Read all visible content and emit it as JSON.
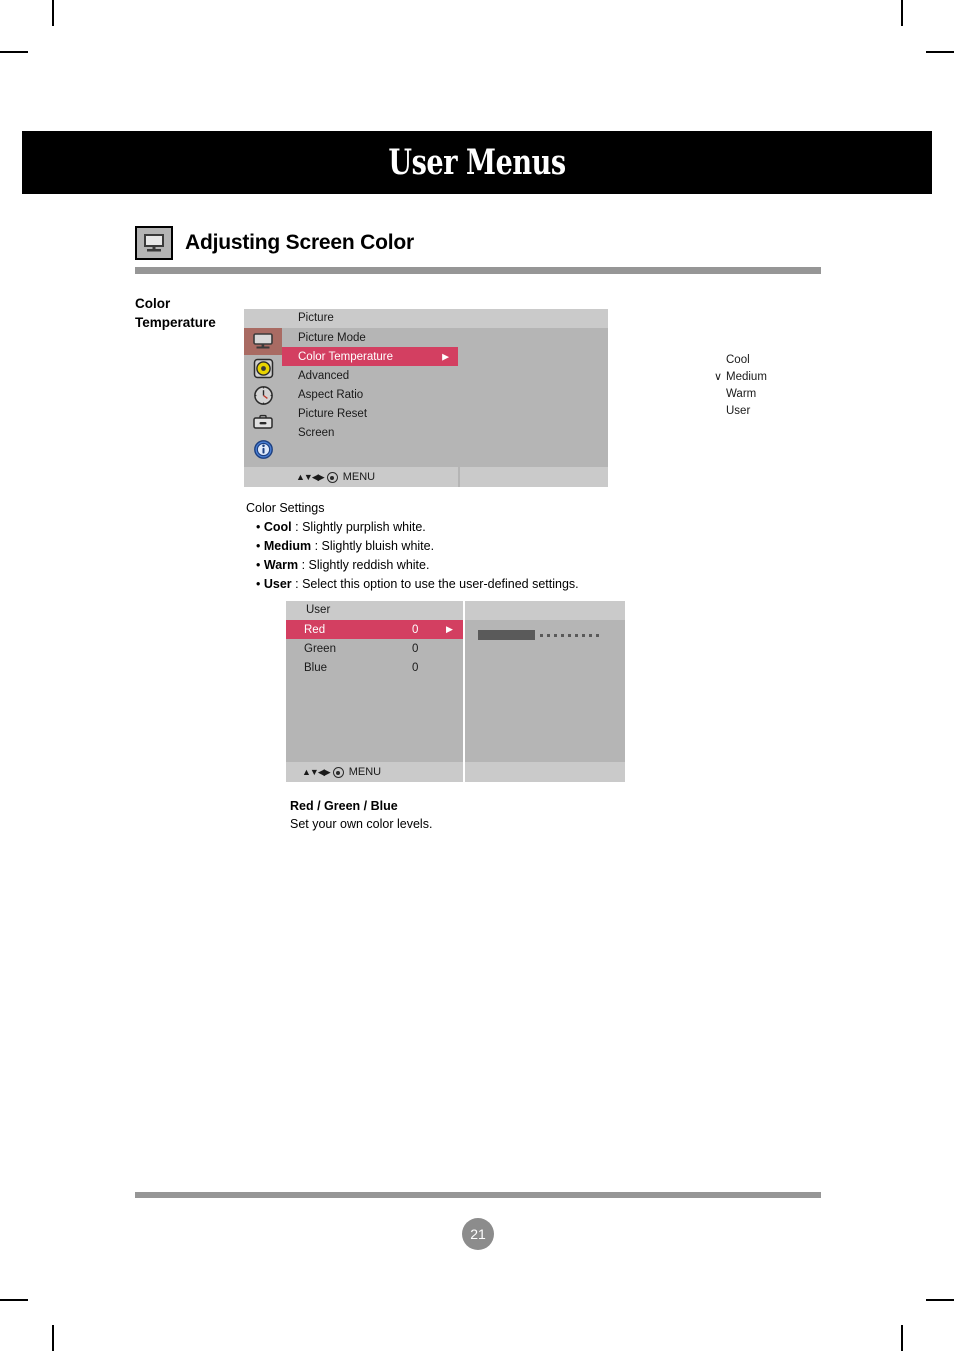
{
  "banner": {
    "title": "User Menus"
  },
  "section": {
    "icon": "monitor-icon",
    "title": "Adjusting Screen Color"
  },
  "side_label": "Color\nTemperature",
  "side_label_line1": "Color",
  "side_label_line2": "Temperature",
  "osd_picture": {
    "header_title": "Picture",
    "rail_icons": [
      {
        "name": "monitor-icon",
        "selected": true
      },
      {
        "name": "audio-disc-icon",
        "selected": false
      },
      {
        "name": "clock-icon",
        "selected": false
      },
      {
        "name": "toolbox-icon",
        "selected": false
      },
      {
        "name": "info-icon",
        "selected": false
      }
    ],
    "menu_items": [
      {
        "label": "Picture Mode",
        "highlighted": false,
        "arrow": ""
      },
      {
        "label": "Color Temperature",
        "highlighted": true,
        "arrow": "▶"
      },
      {
        "label": "Advanced",
        "highlighted": false,
        "arrow": ""
      },
      {
        "label": "Aspect Ratio",
        "highlighted": false,
        "arrow": ""
      },
      {
        "label": "Picture Reset",
        "highlighted": false,
        "arrow": ""
      },
      {
        "label": "Screen",
        "highlighted": false,
        "arrow": ""
      }
    ],
    "options": [
      {
        "label": "Cool",
        "check": ""
      },
      {
        "label": "Medium",
        "check": "∨"
      },
      {
        "label": "Warm",
        "check": ""
      },
      {
        "label": "User",
        "check": ""
      }
    ],
    "footer": {
      "nav_up": "▲",
      "nav_down": "▼",
      "nav_left": "◀",
      "nav_right": "▶",
      "enter": "enter-dot-icon",
      "menu_label": "MENU"
    },
    "highlight_color": "#d33f61"
  },
  "explanation": {
    "heading": "Color Settings",
    "items": [
      {
        "bullet": "•",
        "term": "Cool",
        "desc": " : Slightly purplish white."
      },
      {
        "bullet": "•",
        "term": "Medium",
        "desc": " : Slightly bluish white."
      },
      {
        "bullet": "•",
        "term": "Warm",
        "desc": " : Slightly reddish white."
      },
      {
        "bullet": "•",
        "term": "User",
        "desc": " : Select this option to use the user-defined settings."
      }
    ]
  },
  "osd_user": {
    "header_title": "User",
    "rows": [
      {
        "label": "Red",
        "value": "0",
        "highlighted": true,
        "arrow": "▶"
      },
      {
        "label": "Green",
        "value": "0",
        "highlighted": false,
        "arrow": ""
      },
      {
        "label": "Blue",
        "value": "0",
        "highlighted": false,
        "arrow": ""
      }
    ],
    "slider": {
      "name": "red-level-slider",
      "fill_percent": 50,
      "dot_count": 9
    },
    "footer": {
      "nav_up": "▲",
      "nav_down": "▼",
      "nav_left": "◀",
      "nav_right": "▶",
      "enter": "enter-dot-icon",
      "menu_label": "MENU"
    },
    "highlight_color": "#d33f61"
  },
  "caption": {
    "title": "Red / Green / Blue",
    "text": "Set your own color levels."
  },
  "footer": {
    "page_number": "21"
  }
}
